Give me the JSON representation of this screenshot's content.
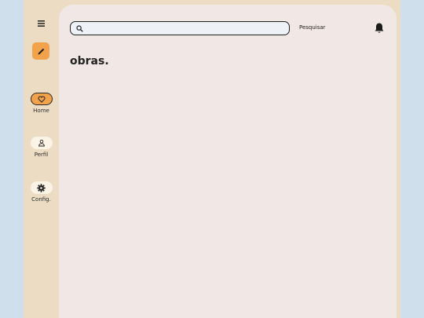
{
  "sidebar": {
    "items": [
      {
        "label": "Home",
        "icon": "heart-icon",
        "active": true
      },
      {
        "label": "Perfil",
        "icon": "user-icon",
        "active": false
      },
      {
        "label": "Config.",
        "icon": "gear-icon",
        "active": false
      }
    ]
  },
  "header": {
    "search_placeholder": "",
    "search_button_label": "Pesquisar"
  },
  "main": {
    "title": "obras."
  },
  "colors": {
    "accent": "#f1a24a",
    "rail_background": "#ecdcc4",
    "content_background": "#f1e8e5",
    "page_background": "#cfe0ec"
  }
}
